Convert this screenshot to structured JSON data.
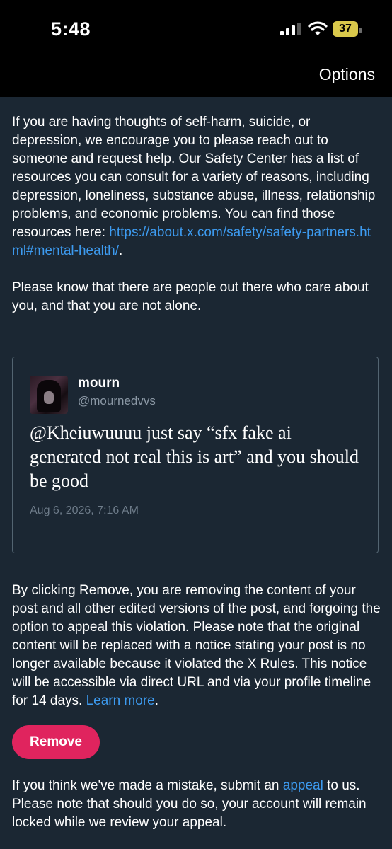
{
  "status_bar": {
    "time": "5:48",
    "battery": "37",
    "battery_color": "#d9c84b"
  },
  "header": {
    "options_label": "Options"
  },
  "notice": {
    "paragraph1_text": "If you are having thoughts of self-harm, suicide, or depression, we encourage you to please reach out to someone and request help. Our Safety Center has a list of resources you can consult for a variety of reasons, including depression, loneliness, substance abuse, illness, relationship problems, and economic problems. You can find those resources here: ",
    "paragraph1_link": "https://about.x.com/safety/safety-partners.html#mental-health/",
    "paragraph1_end": ".",
    "paragraph2_text": "Please know that there are people out there who care about you, and that you are not alone."
  },
  "post": {
    "name": "mourn",
    "handle": "@mournedvvs",
    "text": "@Kheiuwuuuu just say “sfx fake ai generated not real this is art” and you should be good",
    "timestamp": "Aug 6, 2026, 7:16 AM"
  },
  "removal": {
    "text": "By clicking Remove, you are removing the content of your post and all other edited versions of the post, and forgoing the option to appeal this violation. Please note that the original content will be replaced with a notice stating your post is no longer available because it violated the X Rules. This notice will be accessible via direct URL and via your profile timeline for 14 days. ",
    "learn_more": "Learn more",
    "end": ".",
    "button_label": "Remove",
    "button_color": "#e0245e"
  },
  "appeal": {
    "text_before": "If you think we've made a mistake, submit an ",
    "link": "appeal",
    "text_after": " to us. Please note that should you do so, your account will remain locked while we review your appeal."
  },
  "colors": {
    "background": "#1b2733",
    "link": "#3d9bf0"
  }
}
